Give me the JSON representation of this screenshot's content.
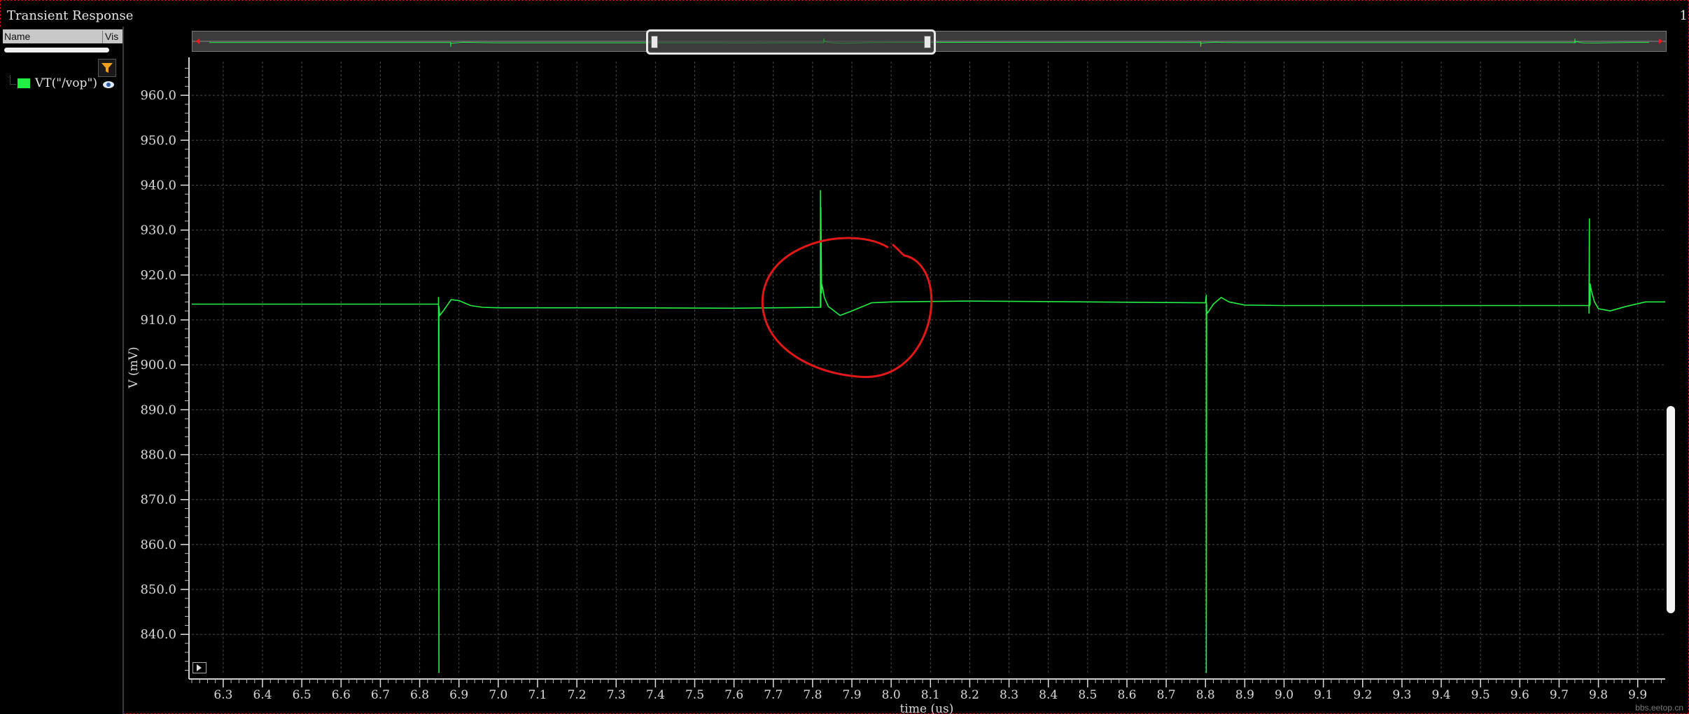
{
  "window": {
    "title": "Transient Response",
    "corner_char": "1"
  },
  "panel": {
    "col_name": "Name",
    "col_vis": "Vis",
    "filter_icon": "filter-funnel-icon",
    "signals": [
      {
        "name": "VT(\"/vop\")",
        "color": "#22ee44",
        "visible_icon": "eye-icon"
      }
    ]
  },
  "watermark": "bbs.eetop.cn",
  "colors": {
    "trace": "#22ee44",
    "annotation": "#e01818",
    "grid": "#4a4a4a",
    "axis_text": "#d8d8d8"
  },
  "chart_data": {
    "type": "line",
    "title": "",
    "xlabel": "time (us)",
    "ylabel": "V (mV)",
    "xlim": [
      6.22,
      9.97
    ],
    "ylim": [
      831.0,
      967.5
    ],
    "x_ticks": [
      6.3,
      6.4,
      6.5,
      6.6,
      6.7,
      6.8,
      6.9,
      7.0,
      7.1,
      7.2,
      7.3,
      7.4,
      7.5,
      7.6,
      7.7,
      7.8,
      7.9,
      8.0,
      8.1,
      8.2,
      8.3,
      8.4,
      8.5,
      8.6,
      8.7,
      8.8,
      8.9,
      9.0,
      9.1,
      9.2,
      9.3,
      9.4,
      9.5,
      9.6,
      9.7,
      9.8,
      9.9
    ],
    "x_tick_labels": [
      "6.3",
      "6.4",
      "6.5",
      "6.6",
      "6.7",
      "6.8",
      "6.9",
      "7.0",
      "7.1",
      "7.2",
      "7.3",
      "7.4",
      "7.5",
      "7.6",
      "7.7",
      "7.8",
      "7.9",
      "8.0",
      "8.1",
      "8.2",
      "8.3",
      "8.4",
      "8.5",
      "8.6",
      "8.7",
      "8.8",
      "8.9",
      "9.0",
      "9.1",
      "9.2",
      "9.3",
      "9.4",
      "9.5",
      "9.6",
      "9.7",
      "9.8",
      "9.9"
    ],
    "y_ticks": [
      840.0,
      850.0,
      860.0,
      870.0,
      880.0,
      890.0,
      900.0,
      910.0,
      920.0,
      930.0,
      940.0,
      950.0,
      960.0
    ],
    "y_tick_labels": [
      "840.0",
      "850.0",
      "860.0",
      "870.0",
      "880.0",
      "890.0",
      "900.0",
      "910.0",
      "920.0",
      "930.0",
      "940.0",
      "950.0",
      "960.0"
    ],
    "grid": true,
    "series": [
      {
        "color": "#22ee44",
        "x": [
          6.22,
          6.848,
          6.848,
          6.849,
          6.849,
          6.851,
          6.86,
          6.88,
          6.9,
          6.93,
          6.96,
          7.0,
          7.3,
          7.6,
          7.82,
          7.82,
          7.821,
          7.821,
          7.823,
          7.823,
          7.826,
          7.83,
          7.84,
          7.87,
          7.9,
          7.95,
          8.0,
          8.2,
          8.5,
          8.8,
          8.802,
          8.802,
          8.803,
          8.803,
          8.805,
          8.82,
          8.84,
          8.86,
          8.9,
          9.0,
          9.3,
          9.6,
          9.776,
          9.776,
          9.777,
          9.777,
          9.779,
          9.779,
          9.782,
          9.79,
          9.8,
          9.83,
          9.87,
          9.92,
          9.97
        ],
        "y": [
          913.5,
          913.5,
          915.0,
          831.5,
          913.0,
          911.0,
          912.0,
          914.5,
          914.3,
          913.2,
          912.8,
          912.7,
          912.7,
          912.6,
          912.8,
          938.8,
          912.8,
          935.0,
          916.0,
          918.0,
          917.0,
          915.0,
          913.0,
          911.0,
          912.0,
          913.8,
          914.0,
          914.2,
          914.0,
          913.8,
          915.5,
          831.5,
          913.5,
          912.0,
          911.5,
          913.5,
          915.0,
          914.0,
          913.3,
          913.2,
          913.2,
          913.2,
          913.2,
          911.5,
          932.5,
          913.0,
          913.5,
          918.0,
          916.5,
          914.0,
          912.5,
          912.0,
          913.0,
          914.0,
          914.0
        ]
      }
    ],
    "overview": {
      "visible_range": [
        6.22,
        9.97
      ]
    }
  }
}
